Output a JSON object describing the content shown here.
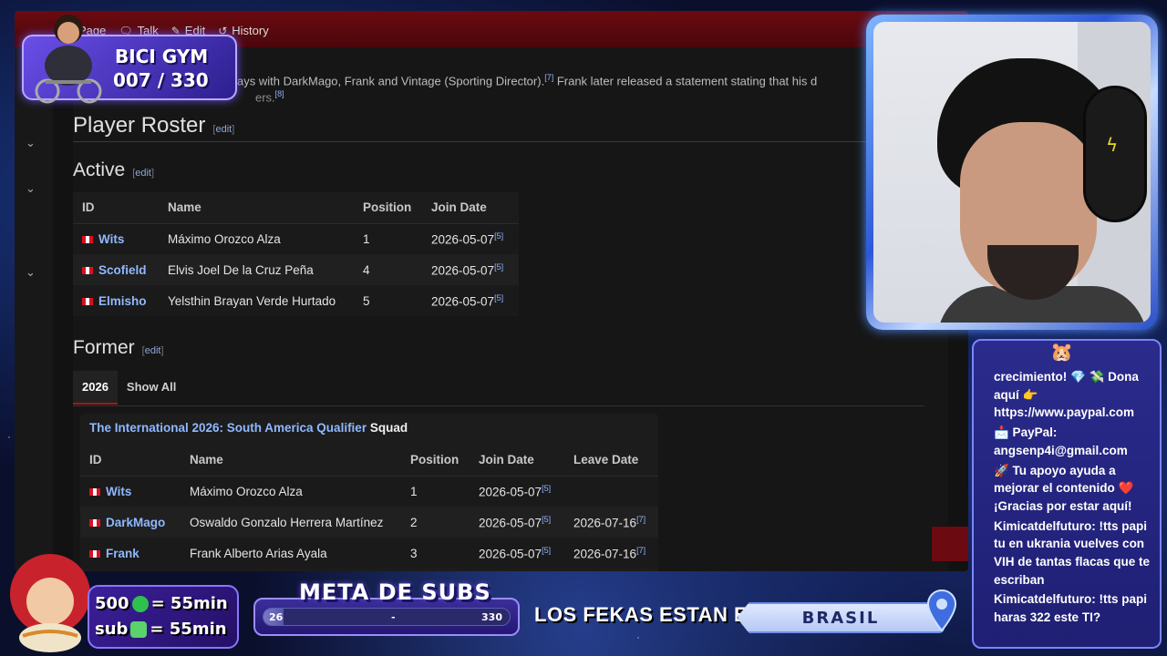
{
  "wiki": {
    "tabs": [
      {
        "label": "Page",
        "icon": "page-icon"
      },
      {
        "label": "Talk",
        "icon": "talk-icon"
      },
      {
        "label": "Edit",
        "icon": "pencil-icon"
      },
      {
        "label": "History",
        "icon": "history-icon"
      }
    ],
    "intro_line": "ays with DarkMago, Frank and Vintage (Sporting Director).",
    "intro_ref1": "[7]",
    "intro_line_b": " Frank later released a statement stating that his d",
    "intro_line2": "ers.",
    "intro_ref2": "[8]",
    "player_roster_heading": "Player Roster",
    "edit_label": "edit",
    "active_heading": "Active",
    "former_heading": "Former",
    "active_table": {
      "headers": [
        "ID",
        "Name",
        "Position",
        "Join Date"
      ],
      "rows": [
        {
          "id": "Wits",
          "name": "Máximo Orozco Alza",
          "position": "1",
          "join": "2026-05-07",
          "join_ref": "[5]"
        },
        {
          "id": "Scofield",
          "name": "Elvis Joel De la Cruz Peña",
          "position": "4",
          "join": "2026-05-07",
          "join_ref": "[5]"
        },
        {
          "id": "Elmisho",
          "name": "Yelsthin Brayan Verde Hurtado",
          "position": "5",
          "join": "2026-05-07",
          "join_ref": "[5]"
        }
      ]
    },
    "former_tabs": [
      "2026",
      "Show All"
    ],
    "squad_link": "The International 2026: South America Qualifier",
    "squad_word": "Squad",
    "former_table": {
      "headers": [
        "ID",
        "Name",
        "Position",
        "Join Date",
        "Leave Date"
      ],
      "rows": [
        {
          "id": "Wits",
          "name": "Máximo Orozco Alza",
          "position": "1",
          "join": "2026-05-07",
          "join_ref": "[5]",
          "leave": "",
          "leave_ref": ""
        },
        {
          "id": "DarkMago",
          "name": "Oswaldo Gonzalo Herrera Martínez",
          "position": "2",
          "join": "2026-05-07",
          "join_ref": "[5]",
          "leave": "2026-07-16",
          "leave_ref": "[7]"
        },
        {
          "id": "Frank",
          "name": "Frank Alberto Arias Ayala",
          "position": "3",
          "join": "2026-05-07",
          "join_ref": "[5]",
          "leave": "2026-07-16",
          "leave_ref": "[7]"
        }
      ]
    }
  },
  "overlay": {
    "gym_title": "BICI GYM",
    "gym_count": "007 / 330",
    "subs_line1_num": "500",
    "subs_line1_val": "= 55min",
    "subs_line2_label": "sub",
    "subs_line2_val": "= 55min",
    "meta_title": "META DE SUBS",
    "meta_start": "26",
    "meta_mid": "-",
    "meta_end": "330",
    "meta_progress": 0.08,
    "fekas_label": "LOS FEKAS ESTAN EN:",
    "country": "BRASIL"
  },
  "chat": {
    "messages": [
      {
        "text": "crecimiento! 💎 💸 Dona aquí 👉 https://www.paypal.com"
      },
      {
        "text": "📩 PayPal: angsenp4i@gmail.com"
      },
      {
        "text": "🚀 Tu apoyo ayuda a mejorar el contenido ❤️ ¡Gracias por estar aquí!"
      },
      {
        "text": "Kimicatdelfuturo: !tts papi tu en ukrania vuelves con VIH de tantas flacas que te escriban"
      },
      {
        "text": "Kimicatdelfuturo: !tts papi haras 322 este TI?"
      }
    ]
  },
  "colors": {
    "topbar": "#6b0a10",
    "link": "#8fb8ff",
    "frame_blue": "#2c58d8"
  }
}
